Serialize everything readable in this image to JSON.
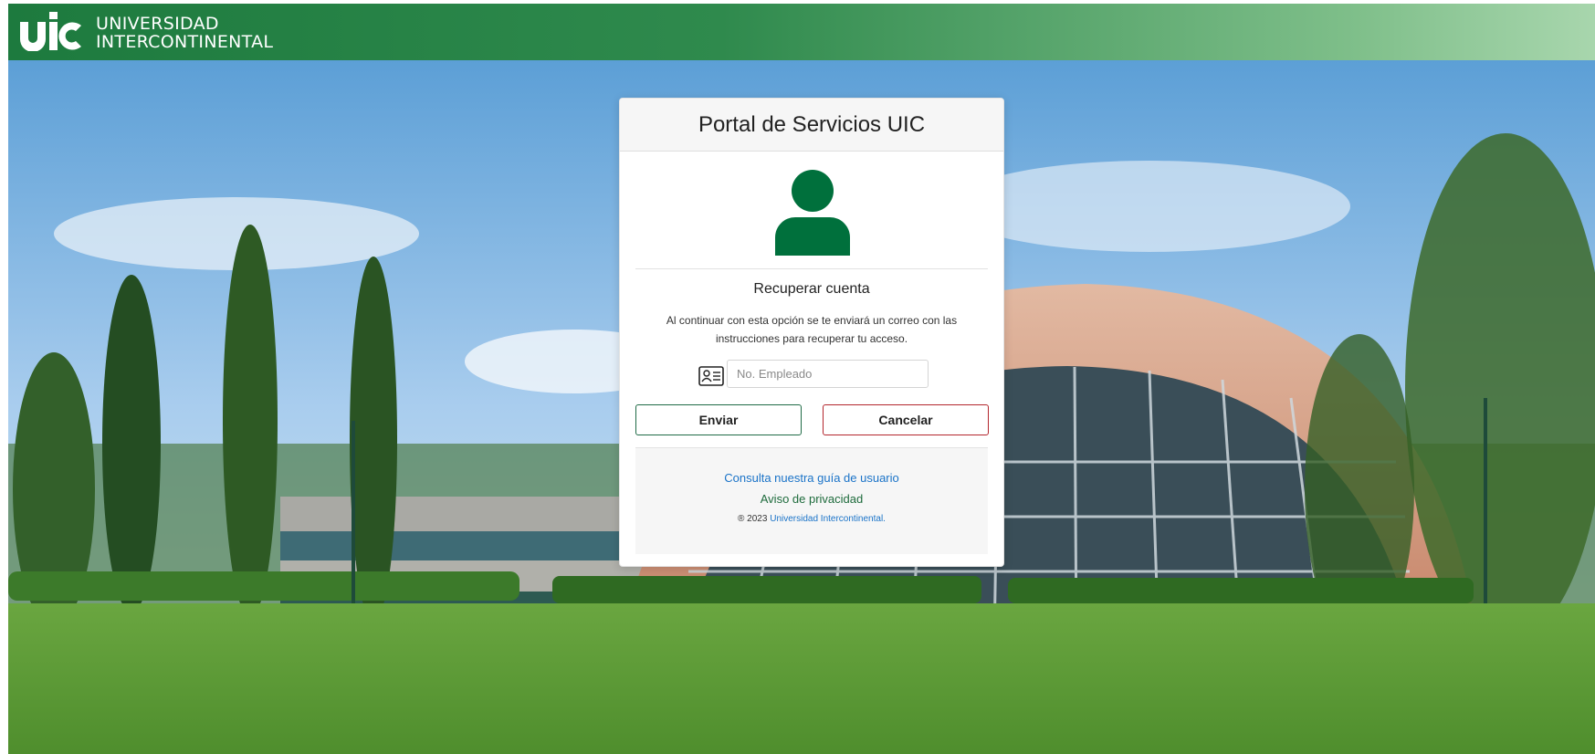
{
  "header": {
    "logo_mark": "uic",
    "logo_line1": "UNIVERSIDAD",
    "logo_line2": "INTERCONTINENTAL",
    "background_color": "#1d7a3e"
  },
  "card": {
    "title": "Portal de Servicios UIC",
    "avatar_icon": "user-icon",
    "subtitle": "Recuperar cuenta",
    "description": "Al continuar con esta opción se te enviará un correo con las instrucciones para recuperar tu acceso.",
    "input": {
      "icon": "id-card-icon",
      "placeholder": "No. Empleado",
      "value": ""
    },
    "buttons": {
      "submit_label": "Enviar",
      "cancel_label": "Cancelar",
      "submit_border_color": "#1f6b46",
      "cancel_border_color": "#b3262d"
    },
    "footer": {
      "guide_link": "Consulta nuestra guía de usuario",
      "privacy_link": "Aviso de privacidad",
      "copyright_prefix": "® 2023",
      "copyright_link": "Universidad Intercontinental."
    }
  },
  "colors": {
    "brand_green": "#00703c",
    "link_blue": "#1a73c8"
  }
}
